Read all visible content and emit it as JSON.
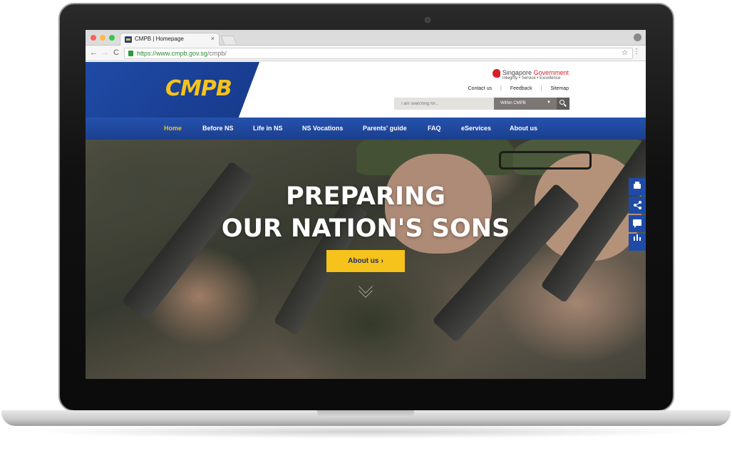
{
  "browser": {
    "tab_title": "CMPB | Homepage",
    "tab_close": "×",
    "url_host": "https://www.cmpb.gov.sg",
    "url_path": "/cmpb/",
    "back": "←",
    "forward": "→",
    "reload": "C",
    "star": "☆",
    "menu": "⋮"
  },
  "header": {
    "logo": "CMPB",
    "gov_brand_a": "Singapore ",
    "gov_brand_b": "Government",
    "gov_tagline": "Integrity  •  Service  •  Excellence",
    "util_links": [
      "Contact us",
      "Feedback",
      "Sitemap"
    ],
    "util_sep": "|",
    "search_placeholder": "I am searching for...",
    "search_scope": "Within CMPB",
    "scope_caret": "▼"
  },
  "nav": {
    "items": [
      "Home",
      "Before NS",
      "Life in NS",
      "NS Vocations",
      "Parents' guide",
      "FAQ",
      "eServices",
      "About us"
    ],
    "active": "Home"
  },
  "hero": {
    "title_line1": "PREPARING",
    "title_line2": "OUR NATION'S SONS",
    "button_label": "About us",
    "button_chevron": "›"
  },
  "side_tools": [
    "print-icon",
    "share-icon",
    "feedback-icon",
    "chart-icon"
  ],
  "colors": {
    "brand_blue": "#1f4ba6",
    "brand_yellow": "#f6c21c",
    "gov_red": "#d71f26"
  }
}
